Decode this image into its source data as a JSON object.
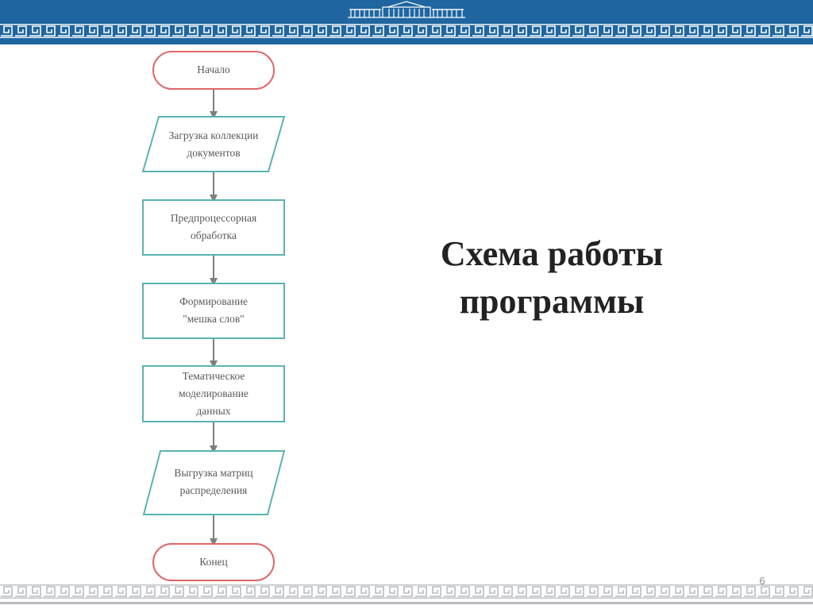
{
  "slide": {
    "title_lines": [
      "Схема работы",
      "программы"
    ],
    "page_number": "6"
  },
  "flowchart": {
    "nodes": [
      {
        "id": "start",
        "shape": "terminator",
        "lines": [
          "Начало"
        ]
      },
      {
        "id": "load",
        "shape": "parallelogram",
        "lines": [
          "Загрузка коллекции",
          "документов"
        ]
      },
      {
        "id": "preprocess",
        "shape": "process",
        "lines": [
          "Предпроцессорная",
          "обработка"
        ]
      },
      {
        "id": "bag",
        "shape": "process",
        "lines": [
          "Формирование",
          "\"мешка слов\""
        ]
      },
      {
        "id": "topic",
        "shape": "process",
        "lines": [
          "Тематическое",
          "моделирование",
          "данных"
        ]
      },
      {
        "id": "export",
        "shape": "parallelogram",
        "lines": [
          "Выгрузка матриц",
          "распределения"
        ]
      },
      {
        "id": "end",
        "shape": "terminator",
        "lines": [
          "Конец"
        ]
      }
    ]
  },
  "colors": {
    "header_band": "#1f66a0",
    "terminator_stroke": "#e06666",
    "node_stroke": "#5ab3b2",
    "arrow": "#7f7f7f",
    "node_text": "#595959"
  },
  "icons": {
    "header_logo": "building-emblem-icon",
    "header_ornament": "greek-key-ornament",
    "footer_ornament": "greek-key-ornament"
  }
}
